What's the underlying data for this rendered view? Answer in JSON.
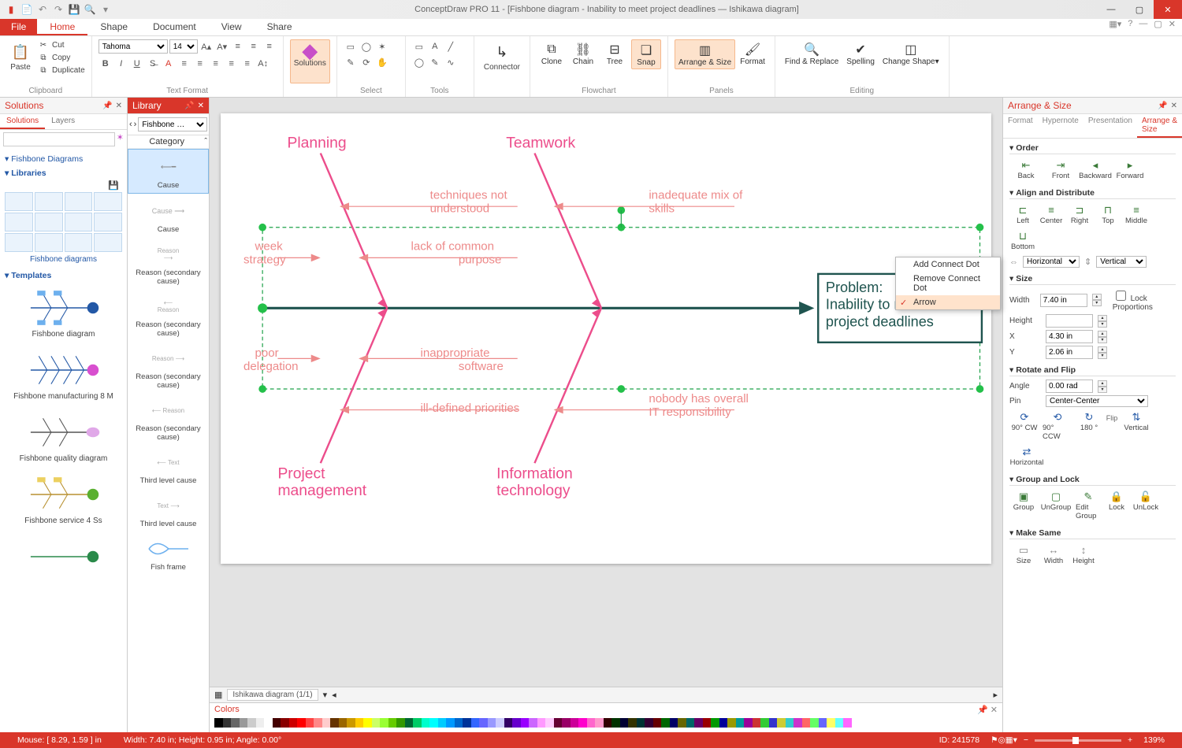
{
  "titlebar": {
    "title": "ConceptDraw PRO 11 - [Fishbone diagram - Inability to meet project deadlines — Ishikawa diagram]"
  },
  "ribbon": {
    "file": "File",
    "tabs": [
      "Home",
      "Shape",
      "Document",
      "View",
      "Share"
    ],
    "active_tab": "Home",
    "clipboard": {
      "paste": "Paste",
      "cut": "Cut",
      "copy": "Copy",
      "duplicate": "Duplicate",
      "group": "Clipboard"
    },
    "textformat": {
      "font": "Tahoma",
      "size": "14",
      "group": "Text Format"
    },
    "solutions": {
      "label": "Solutions"
    },
    "select": {
      "label": "Select"
    },
    "tools": {
      "label": "Tools"
    },
    "connector": {
      "label": "Connector"
    },
    "flowchart": {
      "clone": "Clone",
      "chain": "Chain",
      "tree": "Tree",
      "snap": "Snap",
      "arrange": "Arrange & Size",
      "format": "Format",
      "group": "Flowchart"
    },
    "panels_group": "Panels",
    "editing": {
      "find": "Find & Replace",
      "spelling": "Spelling",
      "change": "Change Shape▾",
      "group": "Editing"
    }
  },
  "solutions_panel": {
    "title": "Solutions",
    "tabs": [
      "Solutions",
      "Layers"
    ],
    "tree": {
      "fishbone": "Fishbone Diagrams",
      "libraries": "Libraries",
      "templates": "Templates"
    },
    "lib_caption": "Fishbone diagrams",
    "templates": [
      "Fishbone diagram",
      "Fishbone manufacturing 8 M",
      "Fishbone quality diagram",
      "Fishbone service 4 Ss"
    ]
  },
  "library_panel": {
    "title": "Library",
    "dropdown": "Fishbone …",
    "cat_header": "Category",
    "items": [
      "Cause",
      "Cause",
      "Reason (secondary cause)",
      "Reason (secondary cause)",
      "Reason (secondary cause)",
      "Reason (secondary cause)",
      "Third level cause",
      "Third level cause",
      "Fish frame"
    ]
  },
  "diagram": {
    "categories": {
      "c1": "Planning",
      "c2": "Teamwork",
      "c3": "Project\nmanagement",
      "c4": "Information\ntechnology"
    },
    "causes": {
      "a1": "techniques not\nunderstood",
      "a2": "lack of common\npurpose",
      "a3": "week\nstrategy",
      "b1": "inadequate mix of\nskills",
      "d1": "poor\ndelegation",
      "d2": "inappropriate\nsoftware",
      "d3": "ill-defined priorities",
      "e1": "nobody has overall\nIT responsibility"
    },
    "problem_label": "Problem:",
    "problem_text": "Inability to meet project deadlines"
  },
  "doc_tab": "Ishikawa diagram (1/1)",
  "colors_title": "Colors",
  "context_menu": {
    "i1": "Add Connect Dot",
    "i2": "Remove Connect Dot",
    "i3": "Arrow"
  },
  "arrange": {
    "title": "Arrange & Size",
    "tabs": [
      "Format",
      "Hypernote",
      "Presentation",
      "Arrange & Size"
    ],
    "sections": {
      "order": {
        "title": "Order",
        "btns": [
          "Back",
          "Front",
          "Backward",
          "Forward"
        ]
      },
      "align": {
        "title": "Align and Distribute",
        "btns": [
          "Left",
          "Center",
          "Right",
          "Top",
          "Middle",
          "Bottom"
        ],
        "h": "Horizontal",
        "v": "Vertical"
      },
      "size": {
        "title": "Size",
        "width_l": "Width",
        "width_v": "7.40 in",
        "height_l": "Height",
        "lock": "Lock Proportions",
        "x_l": "X",
        "x_v": "4.30 in",
        "y_l": "Y",
        "y_v": "2.06 in"
      },
      "rotate": {
        "title": "Rotate and Flip",
        "angle_l": "Angle",
        "angle_v": "0.00 rad",
        "pin_l": "Pin",
        "pin_v": "Center-Center",
        "btns": [
          "90° CW",
          "90° CCW",
          "180 °"
        ],
        "flip": "Flip",
        "flipbtns": [
          "Vertical",
          "Horizontal"
        ]
      },
      "group": {
        "title": "Group and Lock",
        "btns": [
          "Group",
          "UnGroup",
          "Edit Group",
          "Lock",
          "UnLock"
        ]
      },
      "make": {
        "title": "Make Same",
        "btns": [
          "Size",
          "Width",
          "Height"
        ]
      }
    }
  },
  "status": {
    "mouse": "Mouse: [ 8.29, 1.59 ] in",
    "dims": "Width: 7.40 in;  Height: 0.95 in;  Angle: 0.00°",
    "id": "ID: 241578",
    "zoom": "139%"
  }
}
